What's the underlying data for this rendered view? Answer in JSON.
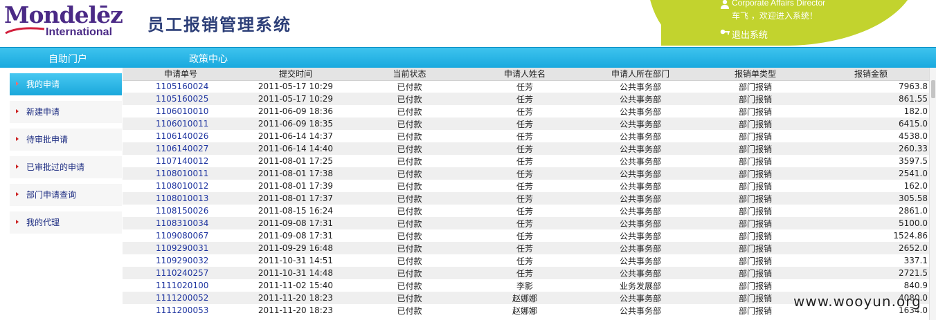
{
  "header": {
    "logo_text": "Mondelēz",
    "logo_sub": "International",
    "system_title": "员工报销管理系统",
    "user_role": "Corporate Affairs Director",
    "user_greeting": "车飞 ，欢迎进入系统！",
    "logout_label": "退出系统",
    "accent_color": "#c2d32e"
  },
  "nav": {
    "items": [
      {
        "label": "自助门户"
      },
      {
        "label": "政策中心"
      }
    ],
    "bar_color": "#19a9de"
  },
  "sidebar": {
    "items": [
      {
        "label": "我的申请",
        "active": true
      },
      {
        "label": "新建申请"
      },
      {
        "label": "待审批申请"
      },
      {
        "label": "已审批过的申请"
      },
      {
        "label": "部门申请查询"
      },
      {
        "label": "我的代理"
      }
    ]
  },
  "table": {
    "columns": [
      "申请单号",
      "提交时间",
      "当前状态",
      "申请人姓名",
      "申请人所在部门",
      "报销单类型",
      "报销金额"
    ],
    "rows": [
      [
        "1105160024",
        "2011-05-17 10:29",
        "已付款",
        "任芳",
        "公共事务部",
        "部门报销",
        "7963.8"
      ],
      [
        "1105160025",
        "2011-05-17 10:29",
        "已付款",
        "任芳",
        "公共事务部",
        "部门报销",
        "861.55"
      ],
      [
        "1106010010",
        "2011-06-09 18:36",
        "已付款",
        "任芳",
        "公共事务部",
        "部门报销",
        "182.0"
      ],
      [
        "1106010011",
        "2011-06-09 18:35",
        "已付款",
        "任芳",
        "公共事务部",
        "部门报销",
        "6415.0"
      ],
      [
        "1106140026",
        "2011-06-14 14:37",
        "已付款",
        "任芳",
        "公共事务部",
        "部门报销",
        "4538.0"
      ],
      [
        "1106140027",
        "2011-06-14 14:40",
        "已付款",
        "任芳",
        "公共事务部",
        "部门报销",
        "260.33"
      ],
      [
        "1107140012",
        "2011-08-01 17:25",
        "已付款",
        "任芳",
        "公共事务部",
        "部门报销",
        "3597.5"
      ],
      [
        "1108010011",
        "2011-08-01 17:38",
        "已付款",
        "任芳",
        "公共事务部",
        "部门报销",
        "2541.0"
      ],
      [
        "1108010012",
        "2011-08-01 17:39",
        "已付款",
        "任芳",
        "公共事务部",
        "部门报销",
        "162.0"
      ],
      [
        "1108010013",
        "2011-08-01 17:37",
        "已付款",
        "任芳",
        "公共事务部",
        "部门报销",
        "305.58"
      ],
      [
        "1108150026",
        "2011-08-15 16:24",
        "已付款",
        "任芳",
        "公共事务部",
        "部门报销",
        "2861.0"
      ],
      [
        "1108310034",
        "2011-09-08 17:31",
        "已付款",
        "任芳",
        "公共事务部",
        "部门报销",
        "5100.0"
      ],
      [
        "1109080067",
        "2011-09-08 17:31",
        "已付款",
        "任芳",
        "公共事务部",
        "部门报销",
        "1524.86"
      ],
      [
        "1109290031",
        "2011-09-29 16:48",
        "已付款",
        "任芳",
        "公共事务部",
        "部门报销",
        "2652.0"
      ],
      [
        "1109290032",
        "2011-10-31 14:51",
        "已付款",
        "任芳",
        "公共事务部",
        "部门报销",
        "337.1"
      ],
      [
        "1110240257",
        "2011-10-31 14:48",
        "已付款",
        "任芳",
        "公共事务部",
        "部门报销",
        "2721.5"
      ],
      [
        "1111020100",
        "2011-11-02 15:40",
        "已付款",
        "李影",
        "业务发展部",
        "部门报销",
        "840.9"
      ],
      [
        "1111200052",
        "2011-11-20 18:23",
        "已付款",
        "赵娜娜",
        "公共事务部",
        "部门报销",
        "4080.0"
      ],
      [
        "1111200053",
        "2011-11-20 18:23",
        "已付款",
        "赵娜娜",
        "公共事务部",
        "部门报销",
        "1634.0"
      ]
    ]
  },
  "watermark": "www.wooyun.org"
}
